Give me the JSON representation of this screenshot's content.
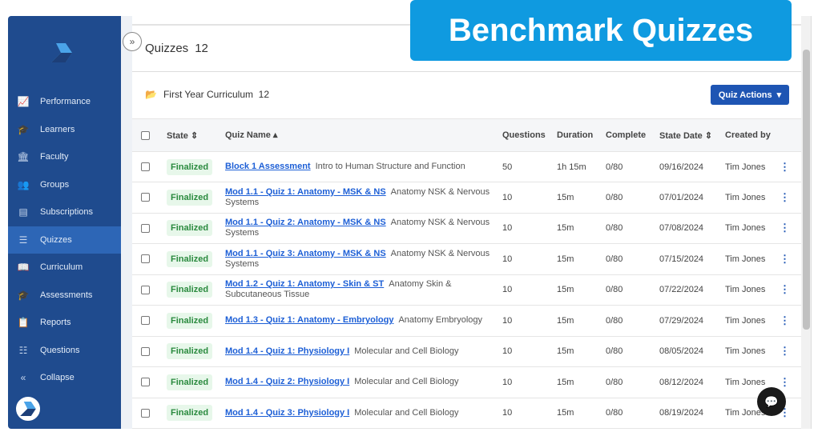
{
  "banner": "Benchmark Quizzes",
  "sidebar": {
    "items": [
      {
        "label": "Performance",
        "icon": "chart-line-icon",
        "glyph": "📈"
      },
      {
        "label": "Learners",
        "icon": "learners-icon",
        "glyph": "🎓"
      },
      {
        "label": "Faculty",
        "icon": "faculty-icon",
        "glyph": "🏛"
      },
      {
        "label": "Groups",
        "icon": "groups-icon",
        "glyph": "👥"
      },
      {
        "label": "Subscriptions",
        "icon": "subscriptions-icon",
        "glyph": "▤"
      },
      {
        "label": "Quizzes",
        "icon": "list-icon",
        "glyph": "☰",
        "active": true
      },
      {
        "label": "Curriculum",
        "icon": "book-icon",
        "glyph": "📖"
      },
      {
        "label": "Assessments",
        "icon": "assessments-icon",
        "glyph": "🎓"
      },
      {
        "label": "Reports",
        "icon": "reports-icon",
        "glyph": "📋"
      },
      {
        "label": "Questions",
        "icon": "questions-icon",
        "glyph": "☷"
      },
      {
        "label": "Collapse",
        "icon": "collapse-icon",
        "glyph": "«"
      }
    ]
  },
  "page": {
    "title": "Quizzes",
    "count": "12",
    "folder": "First Year Curriculum",
    "folder_count": "12",
    "actions": "Quiz Actions"
  },
  "columns": {
    "state": "State",
    "name": "Quiz Name",
    "questions": "Questions",
    "duration": "Duration",
    "complete": "Complete",
    "date": "State Date",
    "by": "Created by"
  },
  "rows": [
    {
      "state": "Finalized",
      "name": "Block 1 Assessment",
      "desc": "Intro to Human Structure and Function",
      "questions": "50",
      "duration": "1h 15m",
      "complete": "0/80",
      "date": "09/16/2024",
      "by": "Tim Jones"
    },
    {
      "state": "Finalized",
      "name": "Mod 1.1 - Quiz 1: Anatomy - MSK & NS",
      "desc": "Anatomy NSK & Nervous Systems",
      "questions": "10",
      "duration": "15m",
      "complete": "0/80",
      "date": "07/01/2024",
      "by": "Tim Jones"
    },
    {
      "state": "Finalized",
      "name": "Mod 1.1 - Quiz 2: Anatomy - MSK & NS",
      "desc": "Anatomy NSK & Nervous Systems",
      "questions": "10",
      "duration": "15m",
      "complete": "0/80",
      "date": "07/08/2024",
      "by": "Tim Jones"
    },
    {
      "state": "Finalized",
      "name": "Mod 1.1 - Quiz 3: Anatomy - MSK & NS",
      "desc": "Anatomy NSK & Nervous Systems",
      "questions": "10",
      "duration": "15m",
      "complete": "0/80",
      "date": "07/15/2024",
      "by": "Tim Jones"
    },
    {
      "state": "Finalized",
      "name": "Mod 1.2 - Quiz 1: Anatomy - Skin & ST",
      "desc": "Anatomy Skin & Subcutaneous Tissue",
      "questions": "10",
      "duration": "15m",
      "complete": "0/80",
      "date": "07/22/2024",
      "by": "Tim Jones"
    },
    {
      "state": "Finalized",
      "name": "Mod 1.3 - Quiz 1: Anatomy - Embryology",
      "desc": "Anatomy Embryology",
      "questions": "10",
      "duration": "15m",
      "complete": "0/80",
      "date": "07/29/2024",
      "by": "Tim Jones"
    },
    {
      "state": "Finalized",
      "name": "Mod 1.4 - Quiz 1: Physiology I",
      "desc": "Molecular and Cell Biology",
      "questions": "10",
      "duration": "15m",
      "complete": "0/80",
      "date": "08/05/2024",
      "by": "Tim Jones"
    },
    {
      "state": "Finalized",
      "name": "Mod 1.4 - Quiz 2: Physiology I",
      "desc": "Molecular and Cell Biology",
      "questions": "10",
      "duration": "15m",
      "complete": "0/80",
      "date": "08/12/2024",
      "by": "Tim Jones"
    },
    {
      "state": "Finalized",
      "name": "Mod 1.4 - Quiz 3: Physiology I",
      "desc": "Molecular and Cell Biology",
      "questions": "10",
      "duration": "15m",
      "complete": "0/80",
      "date": "08/19/2024",
      "by": "Tim Jones"
    }
  ]
}
